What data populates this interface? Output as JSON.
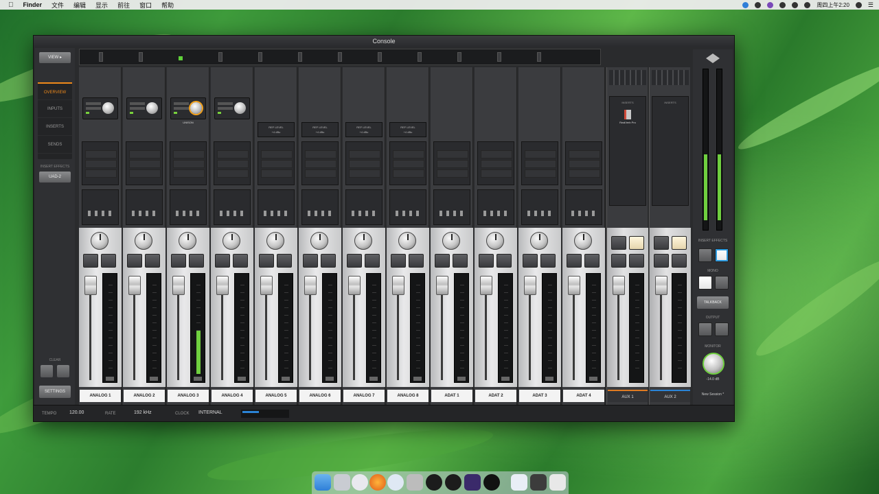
{
  "menubar": {
    "app": "Finder",
    "items": [
      "文件",
      "编辑",
      "显示",
      "前往",
      "窗口",
      "帮助"
    ],
    "clock": "周四上午2:20"
  },
  "window": {
    "title": "Console"
  },
  "left_panel": {
    "view_button": "VIEW ▸",
    "nav": [
      "OVERVIEW",
      "INPUTS",
      "INSERTS",
      "SENDS"
    ],
    "section_label": "INSERT EFFECTS",
    "insert_button": "UAD-2",
    "clear_label": "CLEAR",
    "bottom_button": "SETTINGS"
  },
  "channels": [
    {
      "name": "ANALOG 1",
      "preamp": true,
      "meter": 0
    },
    {
      "name": "ANALOG 2",
      "preamp": true,
      "meter": 0
    },
    {
      "name": "ANALOG 3",
      "preamp": true,
      "hot": true,
      "preamp_label": "UNISON",
      "meter": 0.45
    },
    {
      "name": "ANALOG 4",
      "preamp": true,
      "meter": 0
    },
    {
      "name": "ANALOG 5",
      "line": "REF LEVEL\n+4 dBu",
      "meter": 0
    },
    {
      "name": "ANALOG 6",
      "line": "REF LEVEL\n+4 dBu",
      "meter": 0
    },
    {
      "name": "ANALOG 7",
      "line": "REF LEVEL\n+4 dBu",
      "meter": 0
    },
    {
      "name": "ANALOG 8",
      "line": "REF LEVEL\n+4 dBu",
      "meter": 0
    },
    {
      "name": "ADAT 1",
      "meter": 0
    },
    {
      "name": "ADAT 2",
      "meter": 0
    },
    {
      "name": "ADAT 3",
      "meter": 0
    },
    {
      "name": "ADAT 4",
      "meter": 0
    }
  ],
  "aux": [
    {
      "name": "AUX 1",
      "header": "INSERTS",
      "plugin": "RealVerb Pro"
    },
    {
      "name": "AUX 2",
      "header": "INSERTS"
    }
  ],
  "right_panel": {
    "monitor_label": "INSERT EFFECTS",
    "mono_label": "MONO",
    "talkback_button": "TALKBACK",
    "output_label": "OUTPUT",
    "monitor_knob_label": "MONITOR",
    "monitor_level": "-14.0 dB",
    "session": "New Session *"
  },
  "status": {
    "tempo_label": "TEMPO",
    "tempo": "120.00",
    "rate_label": "RATE",
    "rate": "192 kHz",
    "clock_label": "CLOCK",
    "clock": "INTERNAL",
    "dsp_usage": 0.6
  },
  "colors": {
    "accent": "#f08a1a",
    "meter": "#6fcf3f",
    "aux2": "#2b84d6"
  }
}
